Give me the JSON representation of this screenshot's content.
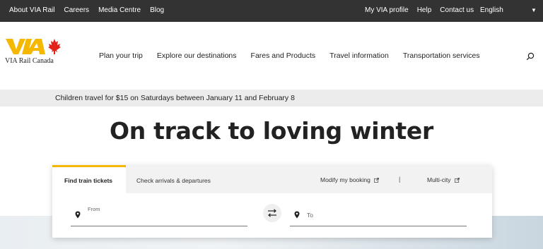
{
  "topbar": {
    "left_links": [
      "About VIA Rail",
      "Careers",
      "Media Centre",
      "Blog"
    ],
    "right_links": [
      "My VIA profile",
      "Help",
      "Contact us"
    ],
    "language": "English"
  },
  "header": {
    "logo_text": "VIA Rail Canada",
    "nav": [
      "Plan your trip",
      "Explore our destinations",
      "Fares and Products",
      "Travel information",
      "Transportation services"
    ]
  },
  "promo": {
    "text": "Children travel for $15 on Saturdays between January 11 and February 8"
  },
  "hero": {
    "title": "On track to loving winter"
  },
  "booking": {
    "tab_active": "Find train tickets",
    "tab_secondary": "Check arrivals & departures",
    "modify_link": "Modify my booking",
    "divider": "|",
    "multicity_link": "Multi-city",
    "from_label": "From",
    "to_label": "To"
  },
  "colors": {
    "accent": "#f5b800",
    "topbar": "#333333",
    "maple_leaf": "#e2231a"
  },
  "icons": [
    "search-icon",
    "location-pin-icon",
    "swap-icon",
    "external-link-icon",
    "chevron-down-icon"
  ]
}
